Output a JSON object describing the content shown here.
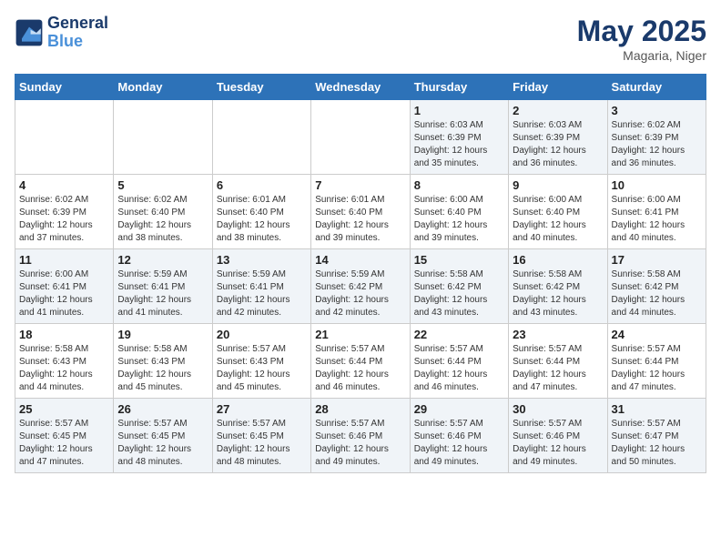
{
  "header": {
    "logo_line1": "General",
    "logo_line2": "Blue",
    "month_year": "May 2025",
    "location": "Magaria, Niger"
  },
  "days_of_week": [
    "Sunday",
    "Monday",
    "Tuesday",
    "Wednesday",
    "Thursday",
    "Friday",
    "Saturday"
  ],
  "weeks": [
    [
      {
        "num": "",
        "info": ""
      },
      {
        "num": "",
        "info": ""
      },
      {
        "num": "",
        "info": ""
      },
      {
        "num": "",
        "info": ""
      },
      {
        "num": "1",
        "info": "Sunrise: 6:03 AM\nSunset: 6:39 PM\nDaylight: 12 hours\nand 35 minutes."
      },
      {
        "num": "2",
        "info": "Sunrise: 6:03 AM\nSunset: 6:39 PM\nDaylight: 12 hours\nand 36 minutes."
      },
      {
        "num": "3",
        "info": "Sunrise: 6:02 AM\nSunset: 6:39 PM\nDaylight: 12 hours\nand 36 minutes."
      }
    ],
    [
      {
        "num": "4",
        "info": "Sunrise: 6:02 AM\nSunset: 6:39 PM\nDaylight: 12 hours\nand 37 minutes."
      },
      {
        "num": "5",
        "info": "Sunrise: 6:02 AM\nSunset: 6:40 PM\nDaylight: 12 hours\nand 38 minutes."
      },
      {
        "num": "6",
        "info": "Sunrise: 6:01 AM\nSunset: 6:40 PM\nDaylight: 12 hours\nand 38 minutes."
      },
      {
        "num": "7",
        "info": "Sunrise: 6:01 AM\nSunset: 6:40 PM\nDaylight: 12 hours\nand 39 minutes."
      },
      {
        "num": "8",
        "info": "Sunrise: 6:00 AM\nSunset: 6:40 PM\nDaylight: 12 hours\nand 39 minutes."
      },
      {
        "num": "9",
        "info": "Sunrise: 6:00 AM\nSunset: 6:40 PM\nDaylight: 12 hours\nand 40 minutes."
      },
      {
        "num": "10",
        "info": "Sunrise: 6:00 AM\nSunset: 6:41 PM\nDaylight: 12 hours\nand 40 minutes."
      }
    ],
    [
      {
        "num": "11",
        "info": "Sunrise: 6:00 AM\nSunset: 6:41 PM\nDaylight: 12 hours\nand 41 minutes."
      },
      {
        "num": "12",
        "info": "Sunrise: 5:59 AM\nSunset: 6:41 PM\nDaylight: 12 hours\nand 41 minutes."
      },
      {
        "num": "13",
        "info": "Sunrise: 5:59 AM\nSunset: 6:41 PM\nDaylight: 12 hours\nand 42 minutes."
      },
      {
        "num": "14",
        "info": "Sunrise: 5:59 AM\nSunset: 6:42 PM\nDaylight: 12 hours\nand 42 minutes."
      },
      {
        "num": "15",
        "info": "Sunrise: 5:58 AM\nSunset: 6:42 PM\nDaylight: 12 hours\nand 43 minutes."
      },
      {
        "num": "16",
        "info": "Sunrise: 5:58 AM\nSunset: 6:42 PM\nDaylight: 12 hours\nand 43 minutes."
      },
      {
        "num": "17",
        "info": "Sunrise: 5:58 AM\nSunset: 6:42 PM\nDaylight: 12 hours\nand 44 minutes."
      }
    ],
    [
      {
        "num": "18",
        "info": "Sunrise: 5:58 AM\nSunset: 6:43 PM\nDaylight: 12 hours\nand 44 minutes."
      },
      {
        "num": "19",
        "info": "Sunrise: 5:58 AM\nSunset: 6:43 PM\nDaylight: 12 hours\nand 45 minutes."
      },
      {
        "num": "20",
        "info": "Sunrise: 5:57 AM\nSunset: 6:43 PM\nDaylight: 12 hours\nand 45 minutes."
      },
      {
        "num": "21",
        "info": "Sunrise: 5:57 AM\nSunset: 6:44 PM\nDaylight: 12 hours\nand 46 minutes."
      },
      {
        "num": "22",
        "info": "Sunrise: 5:57 AM\nSunset: 6:44 PM\nDaylight: 12 hours\nand 46 minutes."
      },
      {
        "num": "23",
        "info": "Sunrise: 5:57 AM\nSunset: 6:44 PM\nDaylight: 12 hours\nand 47 minutes."
      },
      {
        "num": "24",
        "info": "Sunrise: 5:57 AM\nSunset: 6:44 PM\nDaylight: 12 hours\nand 47 minutes."
      }
    ],
    [
      {
        "num": "25",
        "info": "Sunrise: 5:57 AM\nSunset: 6:45 PM\nDaylight: 12 hours\nand 47 minutes."
      },
      {
        "num": "26",
        "info": "Sunrise: 5:57 AM\nSunset: 6:45 PM\nDaylight: 12 hours\nand 48 minutes."
      },
      {
        "num": "27",
        "info": "Sunrise: 5:57 AM\nSunset: 6:45 PM\nDaylight: 12 hours\nand 48 minutes."
      },
      {
        "num": "28",
        "info": "Sunrise: 5:57 AM\nSunset: 6:46 PM\nDaylight: 12 hours\nand 49 minutes."
      },
      {
        "num": "29",
        "info": "Sunrise: 5:57 AM\nSunset: 6:46 PM\nDaylight: 12 hours\nand 49 minutes."
      },
      {
        "num": "30",
        "info": "Sunrise: 5:57 AM\nSunset: 6:46 PM\nDaylight: 12 hours\nand 49 minutes."
      },
      {
        "num": "31",
        "info": "Sunrise: 5:57 AM\nSunset: 6:47 PM\nDaylight: 12 hours\nand 50 minutes."
      }
    ]
  ]
}
